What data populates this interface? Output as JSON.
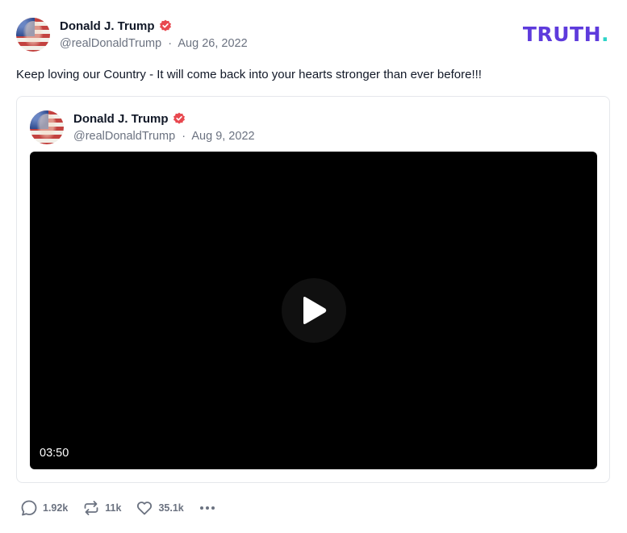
{
  "post": {
    "author": {
      "display_name": "Donald J. Trump",
      "handle": "@realDonaldTrump",
      "date": "Aug 26, 2022",
      "verified_icon": "verified-badge-icon"
    },
    "brand": {
      "name": "TRUTH",
      "dot": ".",
      "colors": {
        "text": "#5e3bdc",
        "dot": "#2dd4c8"
      }
    },
    "text": "Keep loving our Country - It will come back into your hearts stronger than ever before!!!",
    "quoted": {
      "author": {
        "display_name": "Donald J. Trump",
        "handle": "@realDonaldTrump",
        "date": "Aug 9, 2022"
      },
      "video": {
        "duration": "03:50",
        "play_icon": "play-icon"
      }
    },
    "actions": {
      "replies": "1.92k",
      "retruths": "11k",
      "likes": "35.1k",
      "icons": [
        "reply-icon",
        "retruth-icon",
        "heart-icon",
        "more-options-icon"
      ]
    },
    "separator": "·",
    "colors": {
      "verified": "#e8484f",
      "muted": "#6b7280"
    }
  }
}
